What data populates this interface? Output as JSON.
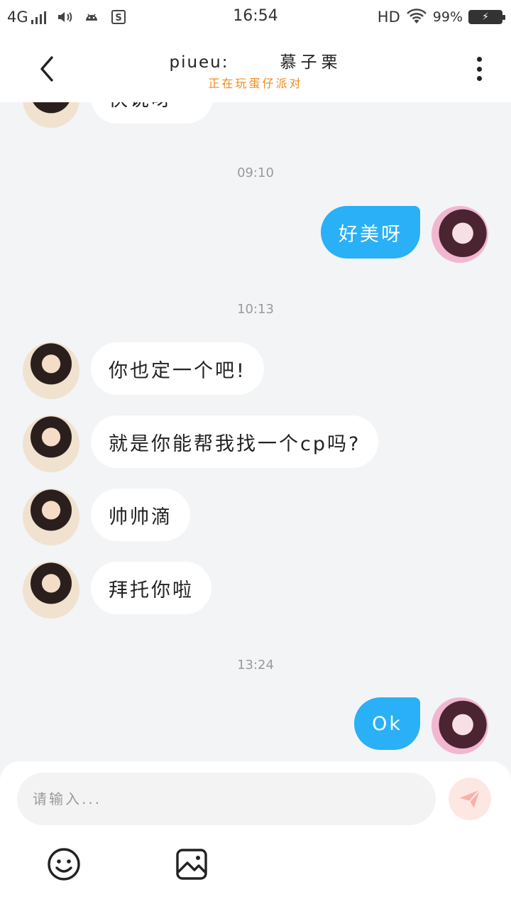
{
  "status_bar": {
    "network": "4G",
    "time": "16:54",
    "hd": "HD",
    "battery_percent": "99%"
  },
  "header": {
    "title_prefix": "piueu:",
    "title_name": "慕子栗",
    "subtitle": "正在玩蛋仔派对"
  },
  "chat": {
    "partial_top_text": "快说呀",
    "messages": [
      {
        "type": "time",
        "text": "09:10"
      },
      {
        "type": "sent",
        "text": "好美呀"
      },
      {
        "type": "time",
        "text": "10:13"
      },
      {
        "type": "received",
        "text": "你也定一个吧!"
      },
      {
        "type": "received",
        "text": "就是你能帮我找一个cp吗?"
      },
      {
        "type": "received",
        "text": "帅帅滴"
      },
      {
        "type": "received",
        "text": "拜托你啦"
      },
      {
        "type": "time",
        "text": "13:24"
      },
      {
        "type": "sent",
        "text": "Ok"
      }
    ]
  },
  "input": {
    "placeholder": "请输入...",
    "value": ""
  },
  "colors": {
    "accent": "#29b0f6",
    "subtitle": "#f08a1c",
    "background": "#f3f4f6",
    "send_button": "#fde7e3"
  },
  "icons": {
    "back": "chevron-left-icon",
    "more": "more-vertical-icon",
    "send": "paper-plane-icon",
    "emoji": "smiley-icon",
    "image": "image-icon"
  }
}
